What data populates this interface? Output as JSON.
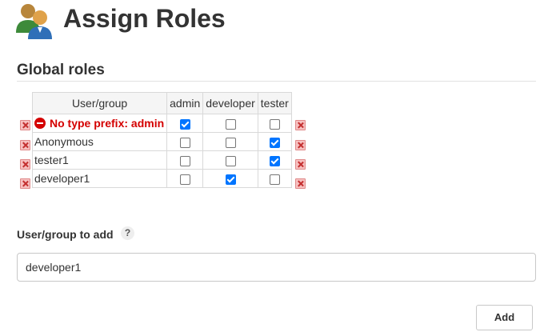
{
  "header": {
    "title": "Assign Roles",
    "icon": "users-icon"
  },
  "global_roles": {
    "section_title": "Global roles",
    "column_header_user": "User/group",
    "roles": [
      "admin",
      "developer",
      "tester"
    ],
    "rows": [
      {
        "label": "No type prefix: admin",
        "warning": true,
        "checks": [
          true,
          false,
          false
        ]
      },
      {
        "label": "Anonymous",
        "warning": false,
        "checks": [
          false,
          false,
          true
        ]
      },
      {
        "label": "tester1",
        "warning": false,
        "checks": [
          false,
          false,
          true
        ]
      },
      {
        "label": "developer1",
        "warning": false,
        "checks": [
          false,
          true,
          false
        ]
      }
    ]
  },
  "add_user": {
    "label": "User/group to add",
    "help_symbol": "?",
    "input_value": "developer1",
    "button_label": "Add"
  },
  "colors": {
    "checkbox_checked": "#0075ff",
    "warning_text": "#d40000",
    "delete_icon": "#c43030"
  }
}
